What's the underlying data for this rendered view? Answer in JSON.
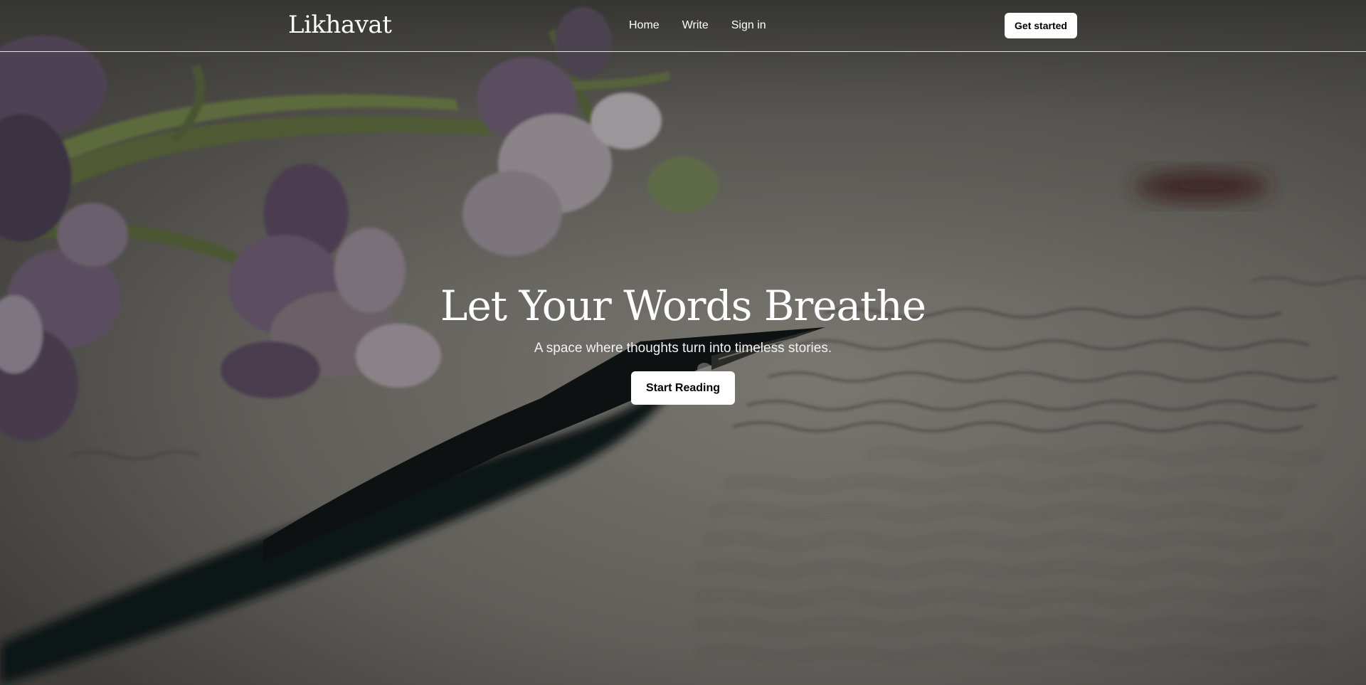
{
  "brand": {
    "logo_text": "Likhavat"
  },
  "nav": {
    "links": [
      {
        "label": "Home"
      },
      {
        "label": "Write"
      },
      {
        "label": "Sign in"
      }
    ],
    "cta_label": "Get started"
  },
  "hero": {
    "title": "Let Your Words Breathe",
    "subtitle": "A space where thoughts turn into timeless stories.",
    "cta_label": "Start Reading",
    "background_image": "flowers-pen-letter-photo"
  },
  "colors": {
    "text_primary": "#ffffff",
    "button_bg": "#ffffff",
    "button_text": "#000000",
    "overlay": "#1c1c1c"
  }
}
